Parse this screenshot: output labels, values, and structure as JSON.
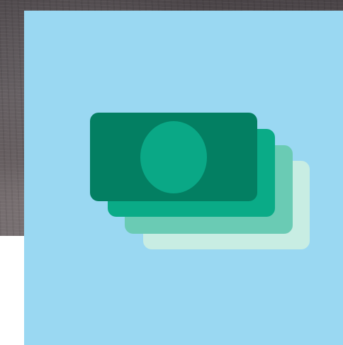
{
  "illustration": {
    "subject": "money-stack-icon",
    "card_color": "#9ad8f2",
    "bill_colors": {
      "back": "#c8ede3",
      "third": "#6acbb4",
      "second": "#0aab87",
      "front": "#037f62",
      "front_emblem": "#0aa886"
    },
    "background_photo": "stone-texture"
  }
}
